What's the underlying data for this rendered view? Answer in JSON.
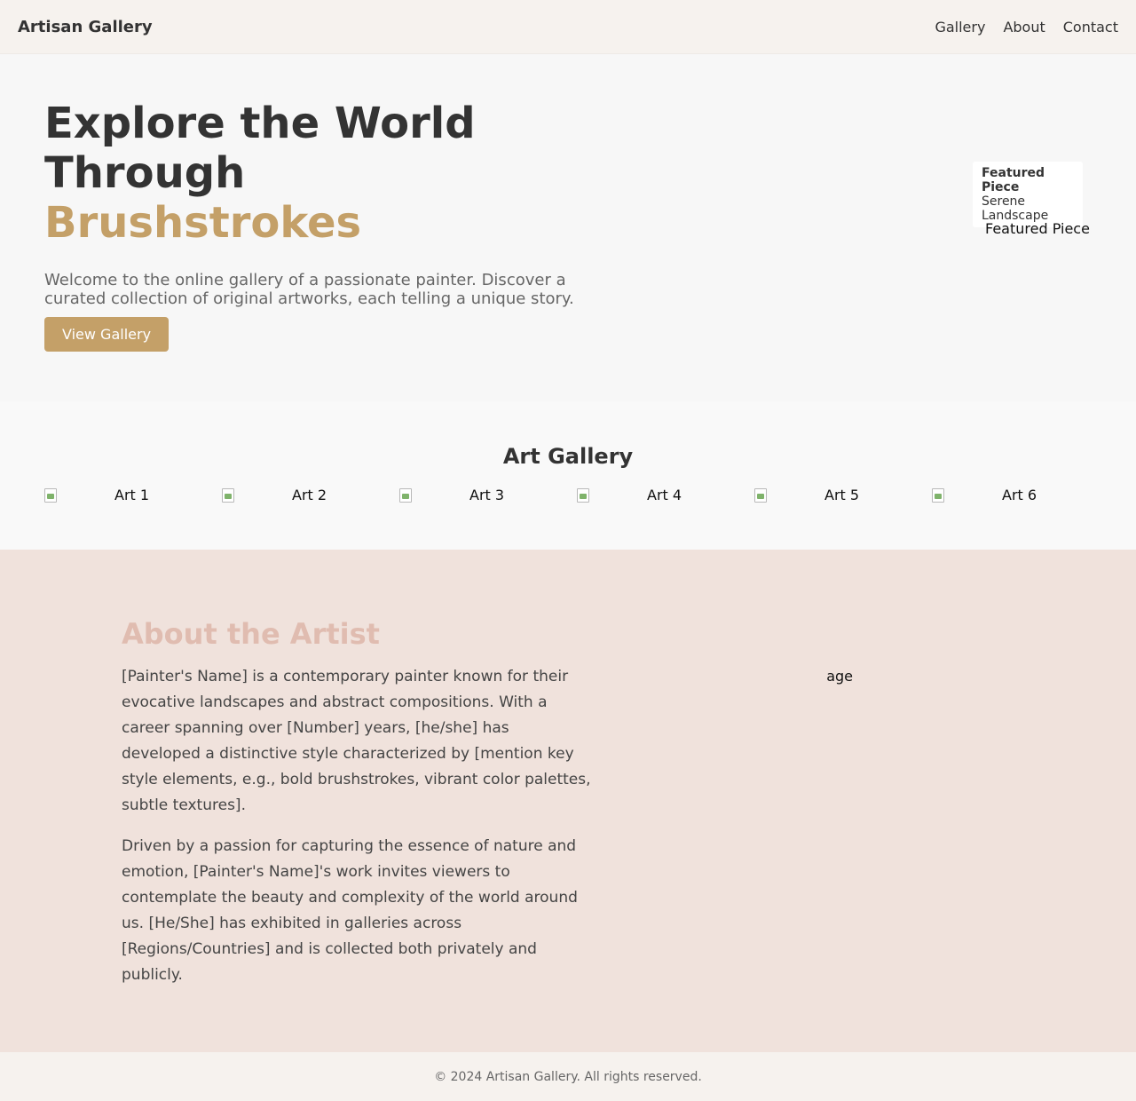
{
  "header": {
    "brand": "Artisan Gallery",
    "nav": [
      "Gallery",
      "About",
      "Contact"
    ]
  },
  "hero": {
    "title_line1": "Explore the World Through",
    "title_accent": "Brushstrokes",
    "description": "Welcome to the online gallery of a passionate painter. Discover a curated collection of original artworks, each telling a unique story.",
    "button_label": "View Gallery",
    "featured": {
      "title": "Featured Piece",
      "name": "Serene Landscape",
      "image_alt": "Featured Piece"
    }
  },
  "gallery": {
    "title": "Art Gallery",
    "items": [
      "Art 1",
      "Art 2",
      "Art 3",
      "Art 4",
      "Art 5",
      "Art 6"
    ]
  },
  "about": {
    "title": "About the Artist",
    "paragraph1": "[Painter's Name] is a contemporary painter known for their evocative landscapes and abstract compositions. With a career spanning over [Number] years, [he/she] has developed a distinctive style characterized by [mention key style elements, e.g., bold brushstrokes, vibrant color palettes, subtle textures].",
    "paragraph2": "Driven by a passion for capturing the essence of nature and emotion, [Painter's Name]'s work invites viewers to contemplate the beauty and complexity of the world around us. [He/She] has exhibited in galleries across [Regions/Countries] and is collected both privately and publicly.",
    "image_alt_fragment": "age"
  },
  "footer": {
    "text": "© 2024 Artisan Gallery. All rights reserved."
  },
  "colors": {
    "accent": "#c4a068",
    "about_heading": "#e0bcb0",
    "about_bg": "#f0e2dc",
    "header_bg": "#f6f2ee"
  }
}
